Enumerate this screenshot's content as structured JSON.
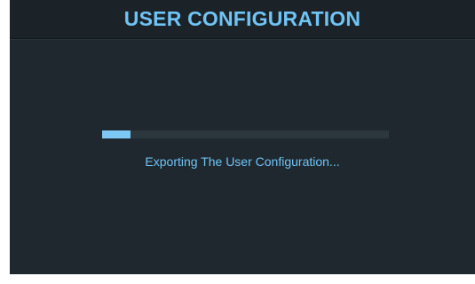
{
  "header": {
    "title": "USER CONFIGURATION"
  },
  "progress": {
    "fraction": 0.1,
    "status_text": "Exporting The User Configuration..."
  },
  "colors": {
    "background": "#1f282e",
    "accent": "#6fc3f5",
    "track": "#2b363d"
  }
}
